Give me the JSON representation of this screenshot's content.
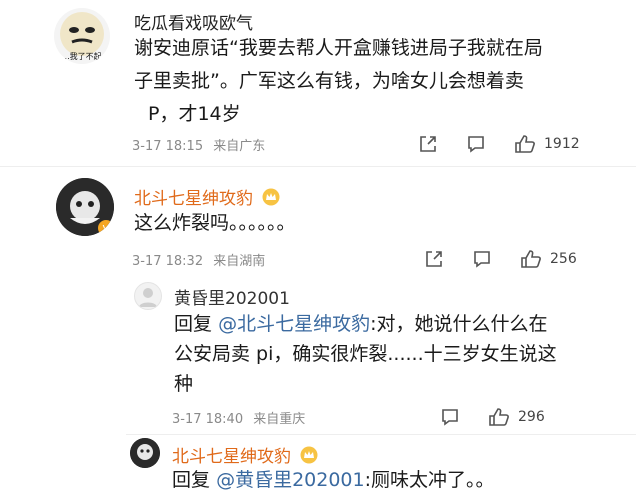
{
  "comments": [
    {
      "username": "吃瓜看戏吸欧气",
      "avatar_caption": "...我了不起",
      "lines": [
        "谢安迪原话“我要去帮人开盒赚钱进局子我就在局",
        "子里卖批”。广军这么有钱，为啥女儿会想着卖",
        "P，才14岁"
      ],
      "date": "3-17 18:15",
      "location": "来自广东",
      "likes": "1912"
    },
    {
      "username": "北斗七星绅攻豹",
      "lines": [
        "这么炸裂吗。。。。。。"
      ],
      "date": "3-17 18:32",
      "location": "来自湖南",
      "likes": "256"
    }
  ],
  "replies": [
    {
      "username": "黄昏里202001",
      "reply_prefix": "回复",
      "mention": "@北斗七星绅攻豹",
      "line1_rest": ":对，她说什么什么在",
      "line2": "公安局卖 pi，确实很炸裂......十三岁女生说这",
      "line3": "种",
      "date": "3-17 18:40",
      "location": "来自重庆",
      "likes": "296"
    },
    {
      "username": "北斗七星绅攻豹",
      "reply_prefix": "回复",
      "mention": "@黄昏里202001",
      "line1_rest": ":厕味太冲了。。"
    }
  ],
  "colors": {
    "name_orange": "#e06a1a",
    "mention_blue": "#3b6aa0",
    "meta_gray": "#8a8a8a"
  },
  "icons": [
    "share-icon",
    "comment-icon",
    "like-icon",
    "vip-crown-icon"
  ]
}
